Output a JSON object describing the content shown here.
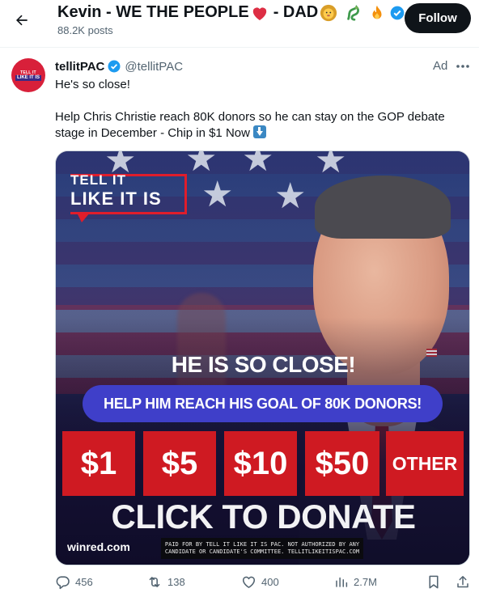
{
  "header": {
    "profile_name": "Kevin - WE THE PEOPLE",
    "suffix_text": "- DAD",
    "posts_count": "88.2K posts",
    "follow_label": "Follow"
  },
  "tweet": {
    "author_name": "tellitPAC",
    "author_handle": "@tellitPAC",
    "ad_label": "Ad",
    "text_line1": "He's so close!",
    "text_line2": "Help Chris Christie reach 80K donors so he can stay on the GOP debate stage in December - Chip in $1 Now",
    "avatar_text_top": "TELL IT",
    "avatar_text_bottom": "LIKE IT IS"
  },
  "ad_creative": {
    "logo_line1": "TELL IT",
    "logo_line2": "LIKE IT IS",
    "headline": "HE IS SO CLOSE!",
    "goal_text": "HELP HIM REACH HIS GOAL OF 80K DONORS!",
    "amounts": [
      "$1",
      "$5",
      "$10",
      "$50",
      "OTHER"
    ],
    "cta": "CLICK TO DONATE",
    "site": "winred.com",
    "disclaimer": "PAID FOR BY TELL IT LIKE IT IS PAC. NOT AUTHORIZED BY ANY CANDIDATE OR CANDIDATE'S COMMITTEE. TELLITLIKEITISPAC.COM"
  },
  "actions": {
    "replies": "456",
    "reposts": "138",
    "likes": "400",
    "views": "2.7M"
  },
  "colors": {
    "verified_blue": "#1d9bf0",
    "follow_bg": "#0f1419",
    "muted_text": "#536471",
    "donate_red": "#cf1a22",
    "goal_pill": "#3f3fc9"
  },
  "icons": [
    "back-arrow-icon",
    "red-heart-icon",
    "lion-icon",
    "dragon-icon",
    "fire-icon",
    "verified-badge-icon",
    "more-icon",
    "down-arrow-emoji-icon",
    "reply-icon",
    "repost-icon",
    "like-icon",
    "views-icon",
    "bookmark-icon",
    "share-icon"
  ]
}
